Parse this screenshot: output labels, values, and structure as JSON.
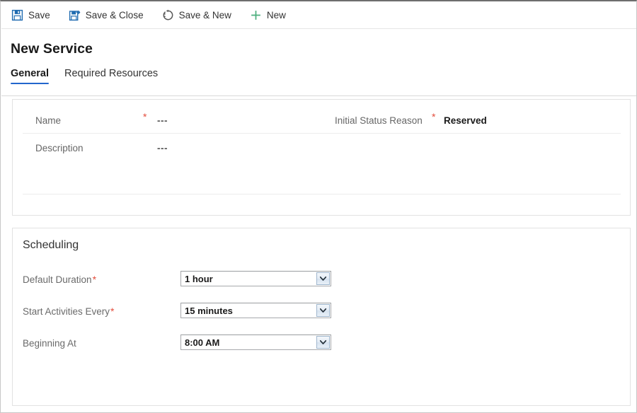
{
  "window": {
    "title": "New Service"
  },
  "commandbar": {
    "buttons": [
      {
        "label": "Save",
        "icon": "save-icon"
      },
      {
        "label": "Save & Close",
        "icon": "save-and-close-icon"
      },
      {
        "label": "Save & New",
        "icon": "save-and-new-icon"
      },
      {
        "label": "New",
        "icon": "plus-icon"
      }
    ]
  },
  "tabs": [
    {
      "label": "General",
      "active": true
    },
    {
      "label": "Required Resources",
      "active": false
    }
  ],
  "general": {
    "fields": [
      {
        "label": "Name",
        "required": true,
        "value": "---"
      },
      {
        "label": "Description",
        "required": false,
        "value": "---"
      },
      {
        "label": "Initial Status Reason",
        "required": true,
        "value": "Reserved"
      }
    ]
  },
  "scheduling": {
    "section_title": "Scheduling",
    "rows": [
      {
        "label": "Default Duration",
        "required": true,
        "value": "1 hour"
      },
      {
        "label": "Start Activities Every",
        "required": true,
        "value": "15 minutes"
      },
      {
        "label": "Beginning At",
        "required": false,
        "value": "8:00 AM"
      }
    ]
  },
  "colors": {
    "accent": "#2266cc",
    "required": "#e34c3b",
    "icon_blue": "#1f6bb0",
    "icon_green": "#4caf7d",
    "icon_gray": "#595959"
  },
  "symbols": {
    "required_star": "*",
    "chevron_down": "˅"
  }
}
